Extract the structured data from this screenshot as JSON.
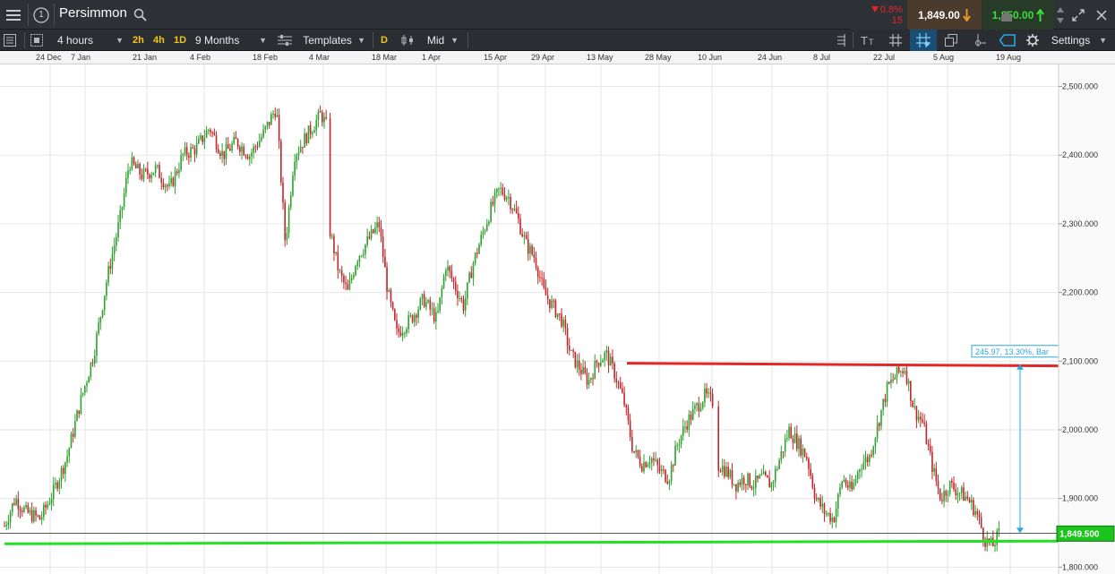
{
  "header": {
    "instrument_number": "1",
    "symbol": "Persimmon",
    "change_pct": "0.8%",
    "change_points": "15",
    "sell_price": "1,849.00",
    "buy_price": "1,850.00"
  },
  "toolbar": {
    "timeframe": "4 hours",
    "quick_tf": [
      "2h",
      "4h",
      "1D"
    ],
    "period": "9 Months",
    "templates_label": "Templates",
    "d_label": "D",
    "price_type": "Mid",
    "settings_label": "Settings"
  },
  "date_axis": [
    "24 Dec",
    "7 Jan",
    "21 Jan",
    "4 Feb",
    "18 Feb",
    "4 Mar",
    "18 Mar",
    "1 Apr",
    "15 Apr",
    "29 Apr",
    "13 May",
    "28 May",
    "10 Jun",
    "24 Jun",
    "8 Jul",
    "22 Jul",
    "5 Aug",
    "19 Aug"
  ],
  "measure_label": "245.97, 13.30%, Bar",
  "current_price_label": "1,849.500",
  "colors": {
    "up": "#2ea12e",
    "down": "#c2262b",
    "resistance": "#e32626",
    "support": "#22e022",
    "measure": "#29a8e0",
    "current_price": "#1ec41e"
  },
  "chart_data": {
    "type": "candlestick",
    "interval": "4 hours",
    "period": "9 Months",
    "y_ticks": [
      "2,500.000",
      "2,400.000",
      "2,300.000",
      "2,200.000",
      "2,100.000",
      "2,000.000",
      "1,900.000",
      "1,800.000"
    ],
    "ylim": [
      1790,
      2532
    ],
    "close_path": [
      [
        0,
        1860
      ],
      [
        12,
        1900
      ],
      [
        24,
        1880
      ],
      [
        40,
        1870
      ],
      [
        55,
        1910
      ],
      [
        70,
        1960
      ],
      [
        85,
        2040
      ],
      [
        100,
        2110
      ],
      [
        115,
        2220
      ],
      [
        130,
        2310
      ],
      [
        140,
        2390
      ],
      [
        155,
        2370
      ],
      [
        170,
        2380
      ],
      [
        185,
        2350
      ],
      [
        200,
        2400
      ],
      [
        215,
        2410
      ],
      [
        230,
        2440
      ],
      [
        245,
        2400
      ],
      [
        260,
        2420
      ],
      [
        275,
        2400
      ],
      [
        290,
        2430
      ],
      [
        305,
        2470
      ],
      [
        315,
        2270
      ],
      [
        325,
        2400
      ],
      [
        340,
        2430
      ],
      [
        355,
        2460
      ],
      [
        362,
        2440
      ],
      [
        365,
        2290
      ],
      [
        375,
        2230
      ],
      [
        385,
        2200
      ],
      [
        395,
        2250
      ],
      [
        405,
        2270
      ],
      [
        420,
        2300
      ],
      [
        430,
        2200
      ],
      [
        440,
        2140
      ],
      [
        455,
        2160
      ],
      [
        470,
        2190
      ],
      [
        485,
        2160
      ],
      [
        495,
        2240
      ],
      [
        505,
        2210
      ],
      [
        515,
        2180
      ],
      [
        525,
        2240
      ],
      [
        535,
        2280
      ],
      [
        545,
        2320
      ],
      [
        555,
        2350
      ],
      [
        565,
        2340
      ],
      [
        575,
        2310
      ],
      [
        585,
        2270
      ],
      [
        595,
        2250
      ],
      [
        605,
        2200
      ],
      [
        615,
        2180
      ],
      [
        625,
        2160
      ],
      [
        635,
        2110
      ],
      [
        645,
        2090
      ],
      [
        655,
        2070
      ],
      [
        665,
        2100
      ],
      [
        675,
        2110
      ],
      [
        685,
        2080
      ],
      [
        695,
        2040
      ],
      [
        705,
        1970
      ],
      [
        715,
        1950
      ],
      [
        725,
        1960
      ],
      [
        735,
        1940
      ],
      [
        745,
        1930
      ],
      [
        755,
        1980
      ],
      [
        765,
        2010
      ],
      [
        775,
        2030
      ],
      [
        785,
        2050
      ],
      [
        795,
        2040
      ],
      [
        800,
        1950
      ],
      [
        810,
        1940
      ],
      [
        820,
        1920
      ],
      [
        830,
        1930
      ],
      [
        840,
        1920
      ],
      [
        850,
        1930
      ],
      [
        860,
        1920
      ],
      [
        870,
        1960
      ],
      [
        880,
        2000
      ],
      [
        890,
        1980
      ],
      [
        900,
        1960
      ],
      [
        910,
        1900
      ],
      [
        920,
        1880
      ],
      [
        930,
        1870
      ],
      [
        940,
        1930
      ],
      [
        950,
        1910
      ],
      [
        960,
        1950
      ],
      [
        970,
        1960
      ],
      [
        980,
        2010
      ],
      [
        990,
        2060
      ],
      [
        1000,
        2080
      ],
      [
        1010,
        2090
      ],
      [
        1020,
        2030
      ],
      [
        1030,
        2010
      ],
      [
        1040,
        1950
      ],
      [
        1050,
        1900
      ],
      [
        1060,
        1920
      ],
      [
        1070,
        1910
      ],
      [
        1080,
        1900
      ],
      [
        1090,
        1880
      ],
      [
        1100,
        1840
      ],
      [
        1108,
        1830
      ],
      [
        1116,
        1850
      ]
    ],
    "resistance_line": {
      "from": "28 May",
      "to": "19 Aug",
      "value_start": 2097,
      "value_end": 2093
    },
    "support_line": {
      "from": "24 Dec",
      "to": "19 Aug",
      "value": 1834
    },
    "current_price": 1849.5,
    "measure": {
      "change": 245.97,
      "change_pct": 13.3,
      "low": 1849.5,
      "high": 2095.5
    }
  }
}
